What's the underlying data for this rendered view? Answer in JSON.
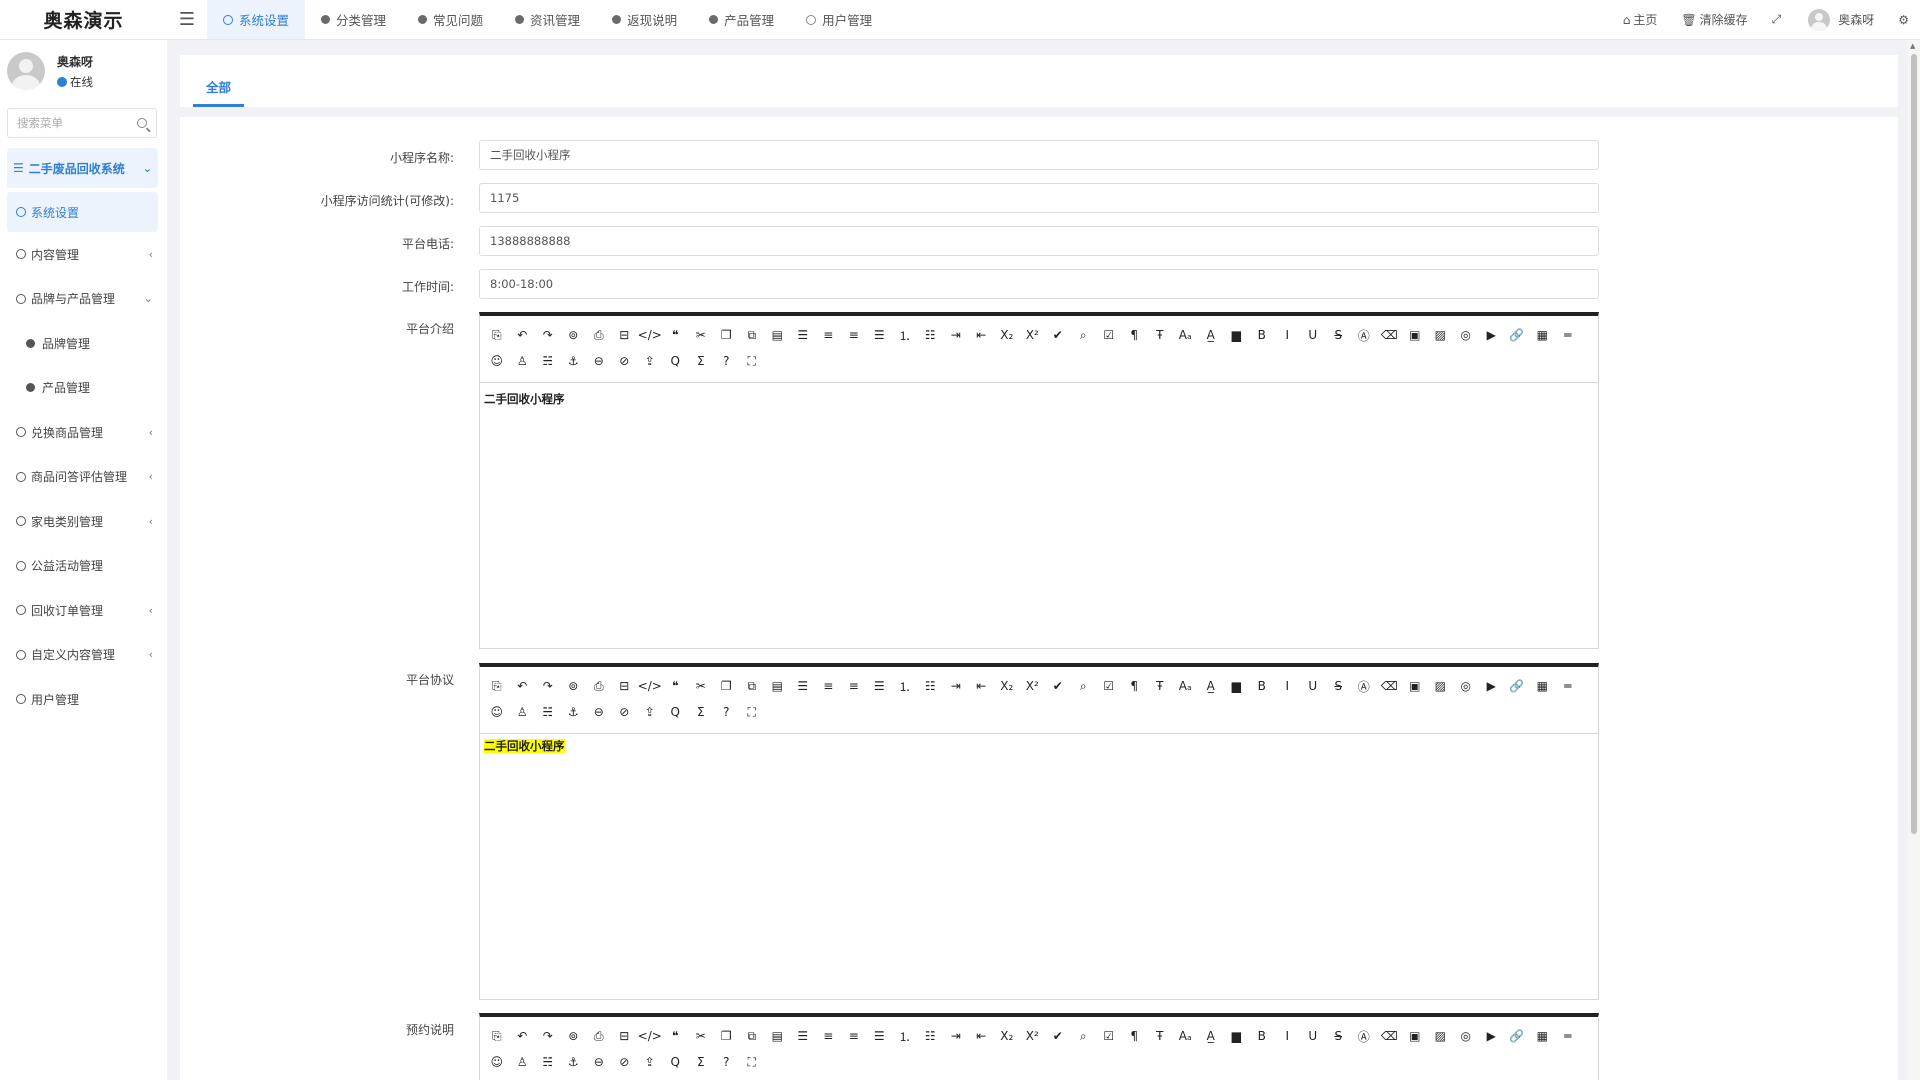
{
  "app": {
    "logo": "奥森演示"
  },
  "topbar": {
    "tabs": [
      {
        "label": "系统设置",
        "icon": "ring",
        "active": true
      },
      {
        "label": "分类管理",
        "icon": "dot"
      },
      {
        "label": "常见问题",
        "icon": "dot"
      },
      {
        "label": "资讯管理",
        "icon": "dot"
      },
      {
        "label": "返现说明",
        "icon": "dot"
      },
      {
        "label": "产品管理",
        "icon": "dot"
      },
      {
        "label": "用户管理",
        "icon": "ring"
      }
    ],
    "home_label": "主页",
    "clear_cache_label": "清除缓存",
    "user_name": "奥森呀"
  },
  "sidebar": {
    "user": {
      "name": "奥森呀",
      "status": "在线"
    },
    "search_placeholder": "搜索菜单",
    "group_title": "二手废品回收系统",
    "items": [
      {
        "label": "系统设置",
        "active": true
      },
      {
        "label": "内容管理",
        "caret": "‹"
      },
      {
        "label": "品牌与产品管理",
        "caret": "⌄"
      },
      {
        "label": "品牌管理",
        "sub": true
      },
      {
        "label": "产品管理",
        "sub": true
      },
      {
        "label": "兑换商品管理",
        "caret": "‹"
      },
      {
        "label": "商品问答评估管理",
        "caret": "‹"
      },
      {
        "label": "家电类别管理",
        "caret": "‹"
      },
      {
        "label": "公益活动管理"
      },
      {
        "label": "回收订单管理",
        "caret": "‹"
      },
      {
        "label": "自定义内容管理",
        "caret": "‹"
      },
      {
        "label": "用户管理"
      }
    ]
  },
  "content": {
    "tab_label": "全部",
    "fields": {
      "name": {
        "label": "小程序名称:",
        "value": "二手回收小程序"
      },
      "visits": {
        "label": "小程序访问统计(可修改):",
        "value": "1175"
      },
      "phone": {
        "label": "平台电话:",
        "value": "13888888888"
      },
      "hours": {
        "label": "工作时间:",
        "value": "8:00-18:00"
      }
    },
    "editors": {
      "intro": {
        "label": "平台介绍",
        "content": "二手回收小程序"
      },
      "agreement": {
        "label": "平台协议",
        "content": "二手回收小程序"
      },
      "booking": {
        "label": "预约说明",
        "content": ""
      }
    }
  },
  "toolbar_icons": [
    "source-icon",
    "undo-icon",
    "redo-icon",
    "format-brush-icon",
    "print-icon",
    "preview-icon",
    "code-icon",
    "quote-icon",
    "cut-icon",
    "copy-icon",
    "paste-text-icon",
    "paste-icon",
    "align-left-icon",
    "align-center-icon",
    "align-right-icon",
    "align-justify-icon",
    "ordered-list-icon",
    "unordered-list-icon",
    "indent-icon",
    "outdent-icon",
    "subscript-icon",
    "superscript-icon",
    "eraser-format-icon",
    "search-replace-icon",
    "checklist-icon",
    "paragraph-icon",
    "font-family-icon",
    "font-size-icon",
    "font-color-icon",
    "bg-color-icon",
    "bold-icon",
    "italic-icon",
    "underline-icon",
    "strikethrough-icon",
    "clear-format-icon",
    "remove-icon",
    "image-icon",
    "multi-image-icon",
    "media-icon",
    "video-icon",
    "link-icon",
    "table-icon",
    "divider-icon",
    "emoji-icon",
    "stamp-icon",
    "hr-icon",
    "anchor-icon",
    "insert-link-icon",
    "unlink-icon",
    "upload-icon",
    "zoom-icon",
    "formula-icon",
    "help-icon",
    "fullscreen-icon"
  ],
  "toolbar_glyphs": [
    "⎘",
    "↶",
    "↷",
    "⊚",
    "⎙",
    "⊟",
    "</>",
    "❝",
    "✂",
    "❐",
    "⧉",
    "▤",
    "☰",
    "≡",
    "≡",
    "☰",
    "⒈",
    "☷",
    "⇥",
    "⇤",
    "X₂",
    "X²",
    "✔",
    "⌕",
    "☑",
    "¶",
    "Ŧ",
    "Aₐ",
    "A̲",
    "▆",
    "B",
    "I",
    "U",
    "S̶",
    "Ⓐ",
    "⌫",
    "▣",
    "▨",
    "◎",
    "▶",
    "🔗",
    "▦",
    "═",
    "☺",
    "♙",
    "☵",
    "⚓",
    "⊖",
    "⊘",
    "⇪",
    "Q",
    "Σ",
    "?",
    "⛶"
  ]
}
